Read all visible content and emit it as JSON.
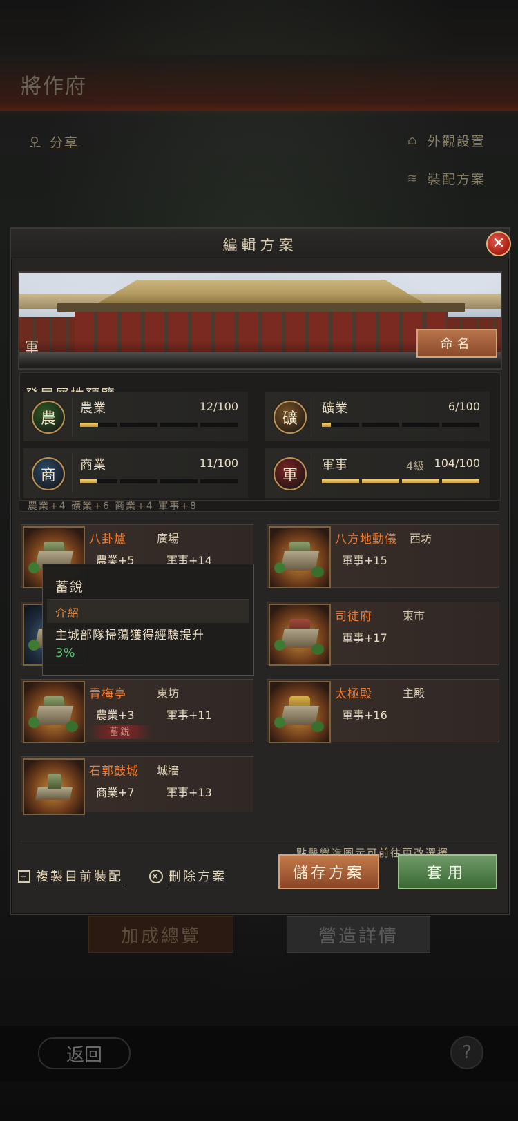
{
  "background": {
    "page_title": "將作府",
    "share_label": "分享",
    "appearance_label": "外觀設置",
    "loadout_label": "裝配方案",
    "bonus_overview_label": "加成總覽",
    "construction_detail_label": "營造詳情",
    "back_label": "返回",
    "help_label": "?"
  },
  "dialog": {
    "title": "編輯方案",
    "close_label": "✕",
    "banner_name": "軍",
    "rename_label": "命名",
    "section_title": "發展屬性預覽",
    "partial_row": "農業+4  礦業+6  商業+4  軍事+8",
    "stats": [
      {
        "icon": "農",
        "name": "農業",
        "value": "12/100",
        "level": "",
        "progress": 0.12,
        "color": "#2e5a24"
      },
      {
        "icon": "礦",
        "name": "礦業",
        "value": "6/100",
        "level": "",
        "progress": 0.06,
        "color": "#7a5222"
      },
      {
        "icon": "商",
        "name": "商業",
        "value": "11/100",
        "level": "",
        "progress": 0.11,
        "color": "#2a4766"
      },
      {
        "icon": "軍",
        "name": "軍事",
        "value": "104/100",
        "level": "4級",
        "progress": 1.0,
        "color": "#7a2222"
      }
    ],
    "buildings": [
      {
        "name": "八卦爐",
        "location": "廣場",
        "bonus1": "農業+5",
        "bonus2": "軍事+14",
        "tag": ""
      },
      {
        "name": "八方地動儀",
        "location": "西坊",
        "bonus1": "軍事+15",
        "bonus2": "",
        "tag": ""
      },
      {
        "name": "司徒府",
        "location": "東市",
        "bonus1": "軍事+17",
        "bonus2": "",
        "tag": ""
      },
      {
        "name": "青梅亭",
        "location": "東坊",
        "bonus1": "農業+3",
        "bonus2": "軍事+11",
        "tag": "蓄銳"
      },
      {
        "name": "太極殿",
        "location": "主殿",
        "bonus1": "軍事+16",
        "bonus2": "",
        "tag": ""
      },
      {
        "name": "石郭鼓城",
        "location": "城牆",
        "bonus1": "商業+7",
        "bonus2": "軍事+13",
        "tag": ""
      }
    ],
    "tooltip": {
      "title": "蓄銳",
      "label": "介紹",
      "description": "主城部隊掃蕩獲得經驗提升",
      "value": "3%"
    },
    "hint": "點擊營造圖示可前往更改選擇",
    "copy_label": "複製目前裝配",
    "delete_label": "刪除方案",
    "save_label": "儲存方案",
    "apply_label": "套用"
  }
}
